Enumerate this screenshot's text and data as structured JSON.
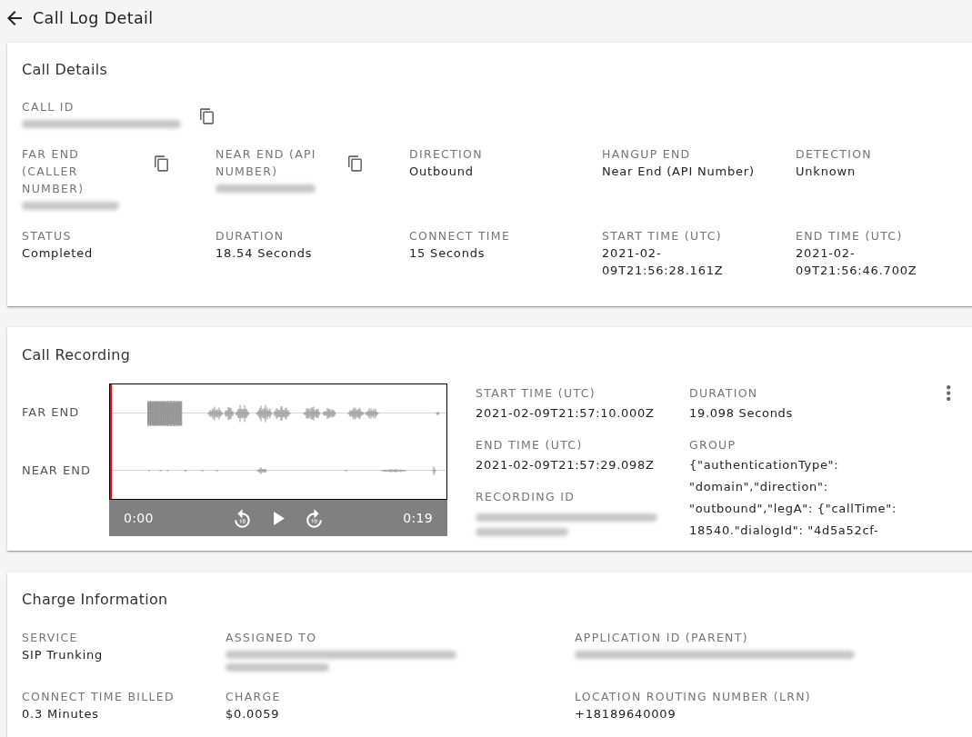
{
  "header": {
    "title": "Call Log Detail"
  },
  "call_details": {
    "title": "Call Details",
    "rows": [
      [
        {
          "label": "CALL ID",
          "kind": "blurred",
          "copy": true
        }
      ],
      [
        {
          "label": "FAR END (CALLER NUMBER)",
          "kind": "blurred",
          "copy": true
        },
        {
          "label": "NEAR END (API NUMBER)",
          "kind": "blurred",
          "copy": true
        },
        {
          "label": "DIRECTION",
          "kind": "text",
          "value": "Outbound"
        },
        {
          "label": "HANGUP END",
          "kind": "text",
          "value": "Near End (API Number)"
        },
        {
          "label": "DETECTION",
          "kind": "text",
          "value": "Unknown"
        }
      ],
      [
        {
          "label": "STATUS",
          "kind": "text",
          "value": "Completed"
        },
        {
          "label": "DURATION",
          "kind": "text",
          "value": "18.54 Seconds"
        },
        {
          "label": "CONNECT TIME",
          "kind": "text",
          "value": "15 Seconds"
        },
        {
          "label": "START TIME (UTC)",
          "kind": "text",
          "value": "2021-02-09T21:56:28.161Z"
        },
        {
          "label": "END TIME (UTC)",
          "kind": "text",
          "value": "2021-02-09T21:56:46.700Z"
        }
      ]
    ]
  },
  "call_recording": {
    "title": "Call Recording",
    "player": {
      "channels": [
        {
          "label": "FAR END"
        },
        {
          "label": "NEAR END"
        }
      ],
      "current_time": "0:00",
      "total_time": "0:19"
    },
    "columns": [
      [
        {
          "label": "START TIME (UTC)",
          "kind": "text",
          "value": "2021-02-09T21:57:10.000Z"
        },
        {
          "label": "END TIME (UTC)",
          "kind": "text",
          "value": "2021-02-09T21:57:29.098Z"
        },
        {
          "label": "RECORDING ID",
          "kind": "blurred"
        }
      ],
      [
        {
          "label": "DURATION",
          "kind": "text",
          "value": "19.098 Seconds"
        },
        {
          "label": "GROUP",
          "kind": "lines",
          "value_lines": [
            "{\"authenticationType\":",
            "\"domain\",\"direction\":",
            "\"outbound\",\"legA\": {\"callTime\":",
            "18540.\"dialogId\": \"4d5a52cf-"
          ]
        }
      ]
    ]
  },
  "charge_information": {
    "title": "Charge Information",
    "rows": [
      [
        {
          "label": "SERVICE",
          "kind": "text",
          "value": "SIP Trunking"
        },
        {
          "label": "ASSIGNED TO",
          "kind": "blurred"
        },
        {
          "label": "APPLICATION ID (PARENT)",
          "kind": "blurred"
        }
      ],
      [
        {
          "label": "CONNECT TIME BILLED",
          "kind": "text",
          "value": "0.3 Minutes"
        },
        {
          "label": "CHARGE",
          "kind": "text",
          "value": "$0.0059"
        },
        {
          "label": "LOCATION ROUTING NUMBER (LRN)",
          "kind": "text",
          "value": "+18189640009"
        }
      ]
    ]
  }
}
